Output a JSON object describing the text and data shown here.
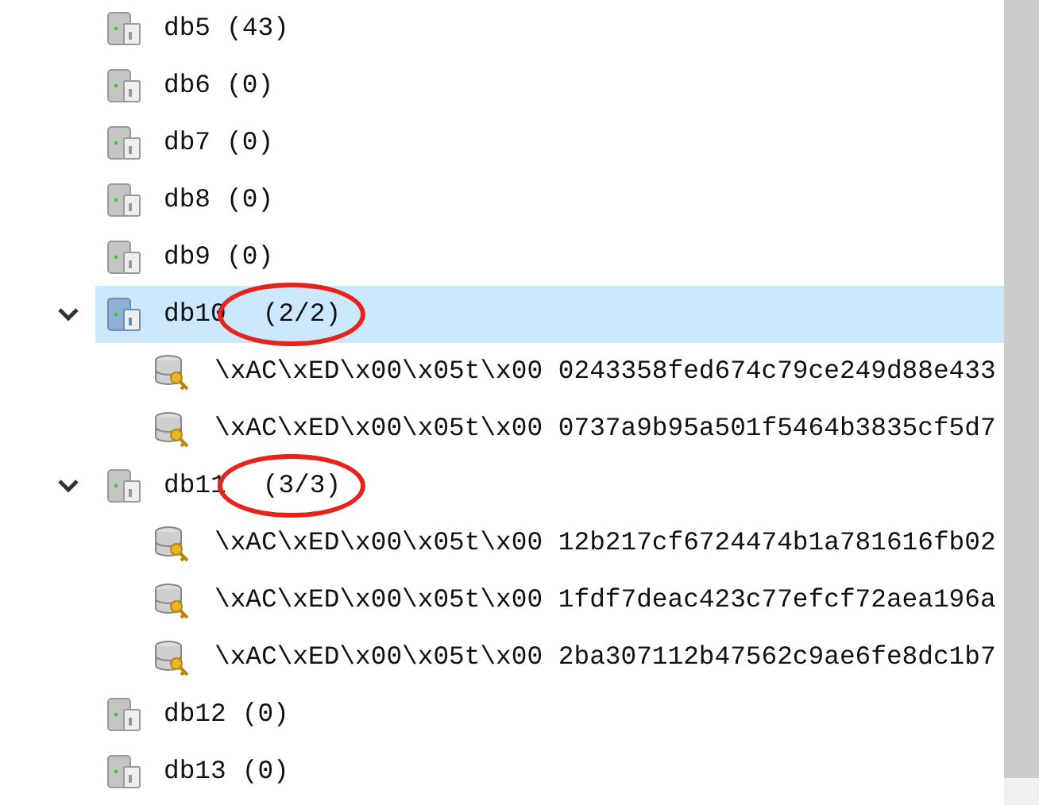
{
  "tree": [
    {
      "name": "db5",
      "count": "(43)",
      "expanded": false,
      "selected": false,
      "circled": false
    },
    {
      "name": "db6",
      "count": "(0)",
      "expanded": false,
      "selected": false,
      "circled": false
    },
    {
      "name": "db7",
      "count": "(0)",
      "expanded": false,
      "selected": false,
      "circled": false
    },
    {
      "name": "db8",
      "count": "(0)",
      "expanded": false,
      "selected": false,
      "circled": false
    },
    {
      "name": "db9",
      "count": "(0)",
      "expanded": false,
      "selected": false,
      "circled": false
    },
    {
      "name": "db10",
      "count": "(2/2)",
      "expanded": true,
      "selected": true,
      "circled": true,
      "children": [
        {
          "name": "\\xAC\\xED\\x00\\x05t\\x00 0243358fed674c79ce249d88e433"
        },
        {
          "name": "\\xAC\\xED\\x00\\x05t\\x00 0737a9b95a501f5464b3835cf5d7"
        }
      ]
    },
    {
      "name": "db11",
      "count": "(3/3)",
      "expanded": true,
      "selected": false,
      "circled": true,
      "children": [
        {
          "name": "\\xAC\\xED\\x00\\x05t\\x00 12b217cf6724474b1a781616fb02"
        },
        {
          "name": "\\xAC\\xED\\x00\\x05t\\x00 1fdf7deac423c77efcf72aea196a"
        },
        {
          "name": "\\xAC\\xED\\x00\\x05t\\x00 2ba307112b47562c9ae6fe8dc1b7"
        }
      ]
    },
    {
      "name": "db12",
      "count": "(0)",
      "expanded": false,
      "selected": false,
      "circled": false
    },
    {
      "name": "db13",
      "count": "(0)",
      "expanded": false,
      "selected": false,
      "circled": false
    }
  ]
}
